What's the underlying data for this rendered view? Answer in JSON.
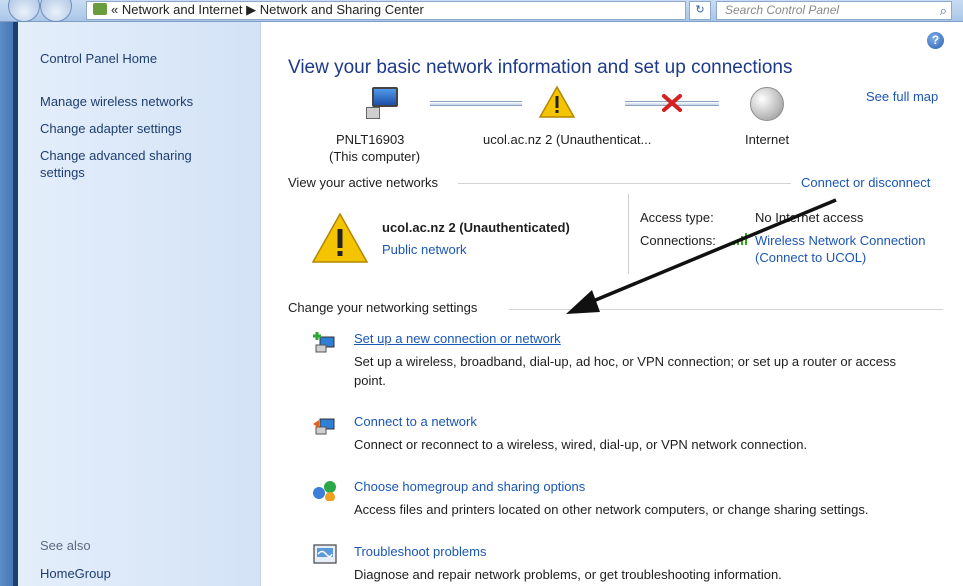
{
  "window": {
    "breadcrumb": "«  Network and Internet  ▶  Network and Sharing Center",
    "search_placeholder": "Search Control Panel"
  },
  "sidebar": {
    "home": "Control Panel Home",
    "items": [
      "Manage wireless networks",
      "Change adapter settings",
      "Change advanced sharing",
      "settings"
    ],
    "see_also_label": "See also",
    "see_also_items": [
      "HomeGroup"
    ]
  },
  "main": {
    "title": "View your basic network information and set up connections",
    "see_full_map": "See full map",
    "map": {
      "computer_name": "PNLT16903",
      "computer_sub": "(This computer)",
      "network_name": "ucol.ac.nz  2 (Unauthenticat...",
      "internet": "Internet"
    },
    "active_networks": {
      "header": "View your active networks",
      "connect_link": "Connect or disconnect",
      "name": "ucol.ac.nz  2 (Unauthenticated)",
      "type": "Public network",
      "access_type_label": "Access type:",
      "access_type_value": "No Internet access",
      "connections_label": "Connections:",
      "connection_line1": "Wireless Network Connection",
      "connection_line2": "(Connect to UCOL)"
    },
    "settings_header": "Change your networking settings",
    "tasks": [
      {
        "title": "Set up a new connection or network",
        "desc1": "Set up a wireless, broadband, dial-up, ad hoc, or VPN connection; or set up a router or access",
        "desc2": "point.",
        "icon": "new-connection-icon"
      },
      {
        "title": "Connect to a network",
        "desc1": "Connect or reconnect to a wireless, wired, dial-up, or VPN network connection.",
        "icon": "connect-network-icon"
      },
      {
        "title": "Choose homegroup and sharing options",
        "desc1": "Access files and printers located on other network computers, or change sharing settings.",
        "icon": "homegroup-icon"
      },
      {
        "title": "Troubleshoot problems",
        "desc1": "Diagnose and repair network problems, or get troubleshooting information.",
        "icon": "troubleshoot-icon"
      }
    ]
  },
  "colors": {
    "link": "#1a56b5",
    "title": "#1d3a8a",
    "sidebar_bg": "#dbe8f8",
    "warning": "#f5c400",
    "error_x": "#d42020"
  }
}
